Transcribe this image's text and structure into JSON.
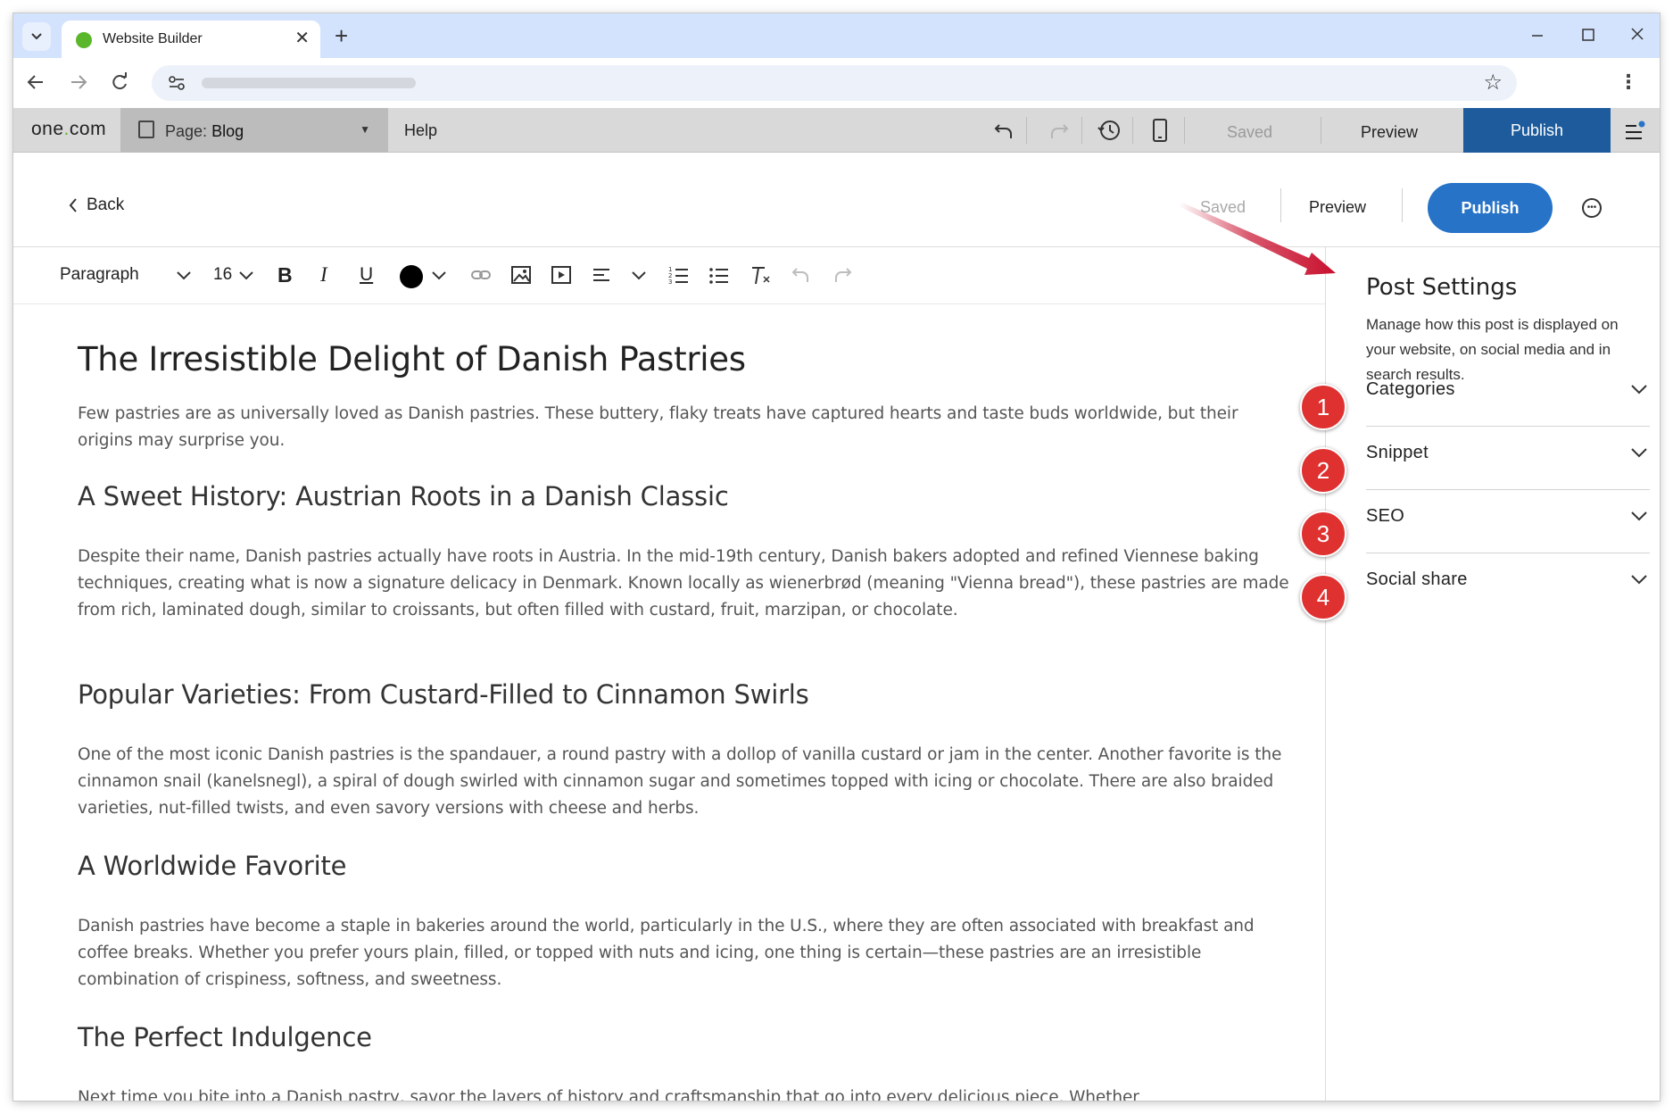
{
  "browser": {
    "tab_title": "Website Builder",
    "tab_close": "✕",
    "new_tab": "+"
  },
  "app": {
    "brand_prefix": "one",
    "brand_dot": ".",
    "brand_suffix": "com",
    "page_prefix": "Page:",
    "page_name": "Blog",
    "help": "Help",
    "saved": "Saved",
    "preview": "Preview",
    "publish": "Publish"
  },
  "editor_header": {
    "back": "Back",
    "saved": "Saved",
    "preview": "Preview",
    "publish": "Publish"
  },
  "format_toolbar": {
    "block_style": "Paragraph",
    "font_size": "16",
    "bold": "B",
    "italic": "I",
    "underline": "U",
    "text_color": "#000000"
  },
  "article": {
    "title": "The Irresistible Delight of Danish Pastries",
    "intro": "Few pastries are as universally loved as Danish pastries. These buttery, flaky treats have captured hearts and taste buds worldwide, but their origins may surprise you.",
    "sections": [
      {
        "heading": "A Sweet History: Austrian Roots in a Danish Classic",
        "body": "Despite their name, Danish pastries actually have roots in Austria. In the mid-19th century, Danish bakers adopted and refined Viennese baking techniques, creating what is now a signature delicacy in Denmark. Known locally as wienerbrød (meaning \"Vienna bread\"), these pastries are made from rich, laminated dough, similar to croissants, but often filled with custard, fruit, marzipan, or chocolate."
      },
      {
        "heading": "Popular Varieties: From Custard-Filled to Cinnamon Swirls",
        "body": "One of the most iconic Danish pastries is the spandauer, a round pastry with a dollop of vanilla custard or jam in the center. Another favorite is the cinnamon snail (kanelsnegl), a spiral of dough swirled with cinnamon sugar and sometimes topped with icing or chocolate. There are also braided varieties, nut-filled twists, and even savory versions with cheese and herbs."
      },
      {
        "heading": "A Worldwide Favorite",
        "body": "Danish pastries have become a staple in bakeries around the world, particularly in the U.S., where they are often associated with breakfast and coffee breaks. Whether you prefer yours plain, filled, or topped with nuts and icing, one thing is certain—these pastries are an irresistible combination of crispiness, softness, and sweetness."
      },
      {
        "heading": "The Perfect Indulgence",
        "body": "Next time you bite into a Danish pastry, savor the layers of history and craftsmanship that go into every delicious piece. Whether"
      }
    ]
  },
  "post_settings": {
    "title": "Post Settings",
    "description": "Manage how this post is displayed on your website, on social media and in search results.",
    "items": [
      {
        "label": "Categories",
        "badge": "1"
      },
      {
        "label": "Snippet",
        "badge": "2"
      },
      {
        "label": "SEO",
        "badge": "3"
      },
      {
        "label": "Social share",
        "badge": "4"
      }
    ]
  },
  "colors": {
    "publish_dark": "#1d5b9c",
    "publish_blue": "#2673c7",
    "badge_red": "#e03131",
    "arrow_red": "#c8102e",
    "brand_green": "#5ab72b",
    "tabbar": "#d3e3fd"
  }
}
